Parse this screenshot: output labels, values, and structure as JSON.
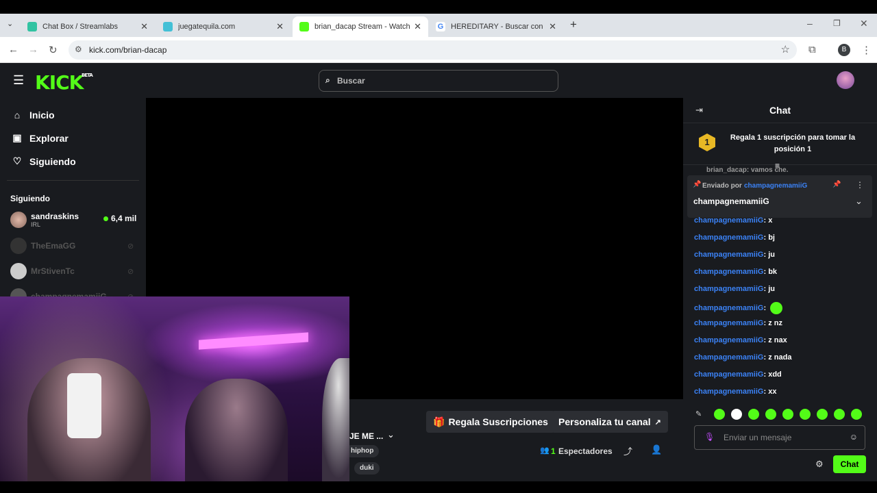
{
  "browser": {
    "tabs": [
      {
        "title": "Chat Box / Streamlabs",
        "favicon_color": "#31c3a2"
      },
      {
        "title": "juegatequila.com",
        "favicon_color": "#43c0d6"
      },
      {
        "title": "brian_dacap Stream - Watch Liv",
        "favicon_color": "#53fc18"
      },
      {
        "title": "HEREDITARY - Buscar con Goog",
        "favicon_color": "#4285f4"
      }
    ],
    "url": "kick.com/brian-dacap",
    "profile_initial": "B"
  },
  "kick": {
    "logo": "KICK",
    "logo_badge": "BETA",
    "search_placeholder": "Buscar",
    "nav": [
      {
        "label": "Inicio",
        "icon": "home-icon"
      },
      {
        "label": "Explorar",
        "icon": "explore-icon"
      },
      {
        "label": "Siguiendo",
        "icon": "heart-icon"
      }
    ],
    "following_title": "Siguiendo",
    "following": [
      {
        "name": "sandraskins",
        "category": "IRL",
        "viewers": "6,4 mil",
        "live": true
      },
      {
        "name": "TheEmaGG",
        "live": false
      },
      {
        "name": "MrStivenTc",
        "live": false
      },
      {
        "name": "champagnemamiiG",
        "live": false
      }
    ]
  },
  "stream": {
    "title_fragment": "JE ME ...",
    "tags": [
      "hiphop",
      "duki"
    ],
    "gift_button": "Regala Suscripciones",
    "customize_button": "Personaliza tu canal",
    "viewer_count": "1",
    "viewer_label": "Espectadores"
  },
  "chat": {
    "title": "Chat",
    "gift_rank": "1",
    "gift_text": "Regala 1 suscripción para tomar la posición 1",
    "partial_message": "brian_dacap: vamos che.",
    "pinned_by_label": "Enviado por",
    "pinned_by_user": "champagnemamiiG",
    "pinned_message": "champagnemamiiG",
    "messages": [
      {
        "user": "champagnemamiiG",
        "text": ": x"
      },
      {
        "user": "champagnemamiiG",
        "text": ": bj"
      },
      {
        "user": "champagnemamiiG",
        "text": ": ju"
      },
      {
        "user": "champagnemamiiG",
        "text": ": bk"
      },
      {
        "user": "champagnemamiiG",
        "text": ": ju"
      },
      {
        "user": "champagnemamiiG",
        "text": ":"
      },
      {
        "user": "champagnemamiiG",
        "text": ": z nz"
      },
      {
        "user": "champagnemamiiG",
        "text": ": z nax"
      },
      {
        "user": "champagnemamiiG",
        "text": ": z nada"
      },
      {
        "user": "champagnemamiiG",
        "text": ": xdd"
      },
      {
        "user": "champagnemamiiG",
        "text": ": xx"
      }
    ],
    "input_placeholder": "Enviar un mensaje",
    "send_button": "Chat"
  },
  "colors": {
    "accent": "#53fc18",
    "username": "#3b82f6",
    "bg": "#191b1f"
  }
}
